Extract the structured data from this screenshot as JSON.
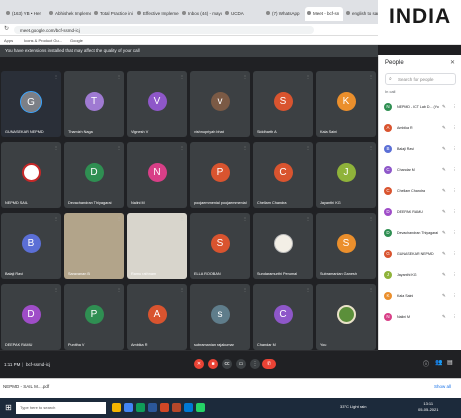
{
  "browser": {
    "tabs": [
      {
        "label": "(163) YB • Her",
        "active": false
      },
      {
        "label": "Abhishek Implemen",
        "active": false
      },
      {
        "label": "Total Practice ini",
        "active": false
      },
      {
        "label": "Effective Impleme",
        "active": false
      },
      {
        "label": "Inbox (44) - mayur",
        "active": false
      },
      {
        "label": "UCDA",
        "active": false
      },
      {
        "label": "(7) WhatsApp",
        "active": false
      },
      {
        "label": "Meet - bcf-sn",
        "active": true
      },
      {
        "label": "english to sanskrit",
        "active": false
      }
    ],
    "url": "meet.google.com/bcf-ssmd-icj",
    "bookmarks": [
      "Apps",
      "Icons & Product Gu...",
      "Google"
    ]
  },
  "logo": {
    "text": "INDIA"
  },
  "meet": {
    "banner": "You have extensions installed that may affect the quality of your call",
    "tiles": [
      {
        "initial": "G",
        "name": "GUNASEKAR NEPMD",
        "color": "#7c7f86",
        "kind": "selfie"
      },
      {
        "initial": "T",
        "name": "Thamizh Naga",
        "color": "#9f7ad2"
      },
      {
        "initial": "V",
        "name": "Vignesh V",
        "color": "#8e57c9"
      },
      {
        "initial": "v",
        "name": "vishnupriyah bhat",
        "color": "#7b5a45"
      },
      {
        "initial": "S",
        "name": "Siddharth A",
        "color": "#d9542f"
      },
      {
        "initial": "K",
        "name": "Kala Saini",
        "color": "#eb8f2c"
      },
      {
        "initial": "",
        "name": "NEPMD SAIL",
        "color": "#ffffff",
        "kind": "logo"
      },
      {
        "initial": "D",
        "name": "Devachandran Thiyagarai",
        "color": "#2f8f52"
      },
      {
        "initial": "N",
        "name": "Nalini M",
        "color": "#d83f87"
      },
      {
        "initial": "P",
        "name": "poojaemmenial poojaemmenial",
        "color": "#d9542f"
      },
      {
        "initial": "C",
        "name": "Chellam Chandra",
        "color": "#d9542f"
      },
      {
        "initial": "J",
        "name": "Jayanthi KG",
        "color": "#8fb33a"
      },
      {
        "initial": "B",
        "name": "Balaji Ravi",
        "color": "#5b6fd6"
      },
      {
        "initial": "",
        "name": "Saravanan B",
        "color": "#b2a48a",
        "kind": "photo"
      },
      {
        "initial": "",
        "name": "Ramu rathnam",
        "color": "#d8d5cc",
        "kind": "photo2"
      },
      {
        "initial": "S",
        "name": "ELLA ROOBAN",
        "color": "#d9542f"
      },
      {
        "initial": "",
        "name": "Sundaramurthi Perumal",
        "color": "#eeeeee",
        "kind": "portrait"
      },
      {
        "initial": "S",
        "name": "Subramanian Ganesh",
        "color": "#eb8f2c"
      },
      {
        "initial": "D",
        "name": "DEEPAK RAMU",
        "color": "#9f4dc8"
      },
      {
        "initial": "P",
        "name": "Punitha V",
        "color": "#2f8f52"
      },
      {
        "initial": "A",
        "name": "Ambika R",
        "color": "#d9542f"
      },
      {
        "initial": "s",
        "name": "subramanian rajakumar",
        "color": "#5f7d8b"
      },
      {
        "initial": "C",
        "name": "Chandar M",
        "color": "#8e57c9"
      },
      {
        "initial": "",
        "name": "You",
        "color": "#e9e2c8",
        "kind": "emblem"
      }
    ]
  },
  "controls": {
    "time": "1:11 PM",
    "meeting_code": "bcf-ssmd-icj"
  },
  "people": {
    "title": "People",
    "search_placeholder": "Search for people",
    "section": "In call",
    "list": [
      {
        "initial": "N",
        "name": "NEPMD - ICT Lab D... (You)",
        "color": "#2f8f52"
      },
      {
        "initial": "A",
        "name": "Ambika R",
        "color": "#d9542f"
      },
      {
        "initial": "B",
        "name": "Balaji Ravi",
        "color": "#5b6fd6"
      },
      {
        "initial": "C",
        "name": "Chandar M",
        "color": "#8e57c9"
      },
      {
        "initial": "C",
        "name": "Chellam Chandra",
        "color": "#d9542f"
      },
      {
        "initial": "D",
        "name": "DEEPAK RAMU",
        "color": "#9f4dc8"
      },
      {
        "initial": "D",
        "name": "Devachandran Thiyagarai",
        "color": "#2f8f52"
      },
      {
        "initial": "G",
        "name": "GUNASEKAR NEPMD",
        "color": "#d9542f"
      },
      {
        "initial": "J",
        "name": "Jayanthi KG",
        "color": "#8fb33a"
      },
      {
        "initial": "K",
        "name": "Kala Saini",
        "color": "#eb8f2c"
      },
      {
        "initial": "N",
        "name": "Nalini M",
        "color": "#d83f87"
      }
    ]
  },
  "downloads": {
    "item": "NEPMD - SAIL M....pdf",
    "show_all": "Show all"
  },
  "taskbar": {
    "search": "Type here to search",
    "weather": "33°C  Light rain",
    "time": "13:11",
    "date": "05-05-2021"
  }
}
